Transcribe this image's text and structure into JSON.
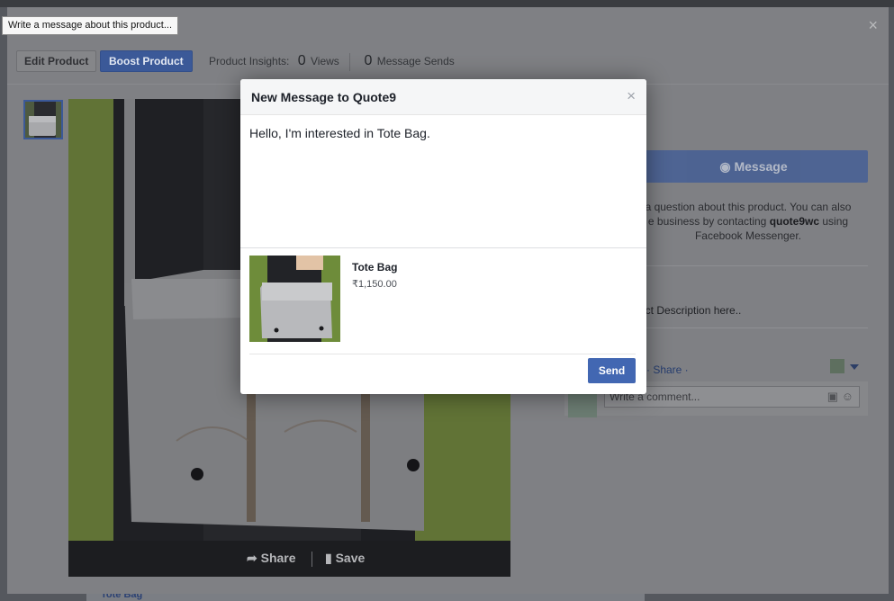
{
  "tooltip": "Write a message about this product...",
  "lightbox": {
    "close_glyph": "×",
    "edit_label": "Edit Product",
    "boost_label": "Boost Product",
    "insights_label": "Product Insights:",
    "views_count": "0",
    "views_label": "Views",
    "sends_count": "0",
    "sends_label": "Message Sends",
    "share_label": "Share",
    "save_label": "Save"
  },
  "right_panel": {
    "message_label": "Message",
    "hint_line1": "a question about this product. You can also",
    "hint_line2_pre": "e business by contacting",
    "hint_business": "quote9wc",
    "hint_line2_post": "using",
    "hint_line3": "Facebook Messenger.",
    "description": "uct Description here..",
    "share_link": "· Share ·",
    "comment_placeholder": "Write a comment..."
  },
  "modal": {
    "title": "New Message to Quote9",
    "close_glyph": "×",
    "message_text": "Hello, I'm interested in Tote Bag.",
    "product_name": "Tote Bag",
    "product_price": "₹1,150.00",
    "send_label": "Send"
  },
  "backdrop": {
    "bottom_link": "Tote Bag"
  },
  "colors": {
    "brand_blue": "#3b5998",
    "send_blue": "#4267b2"
  }
}
